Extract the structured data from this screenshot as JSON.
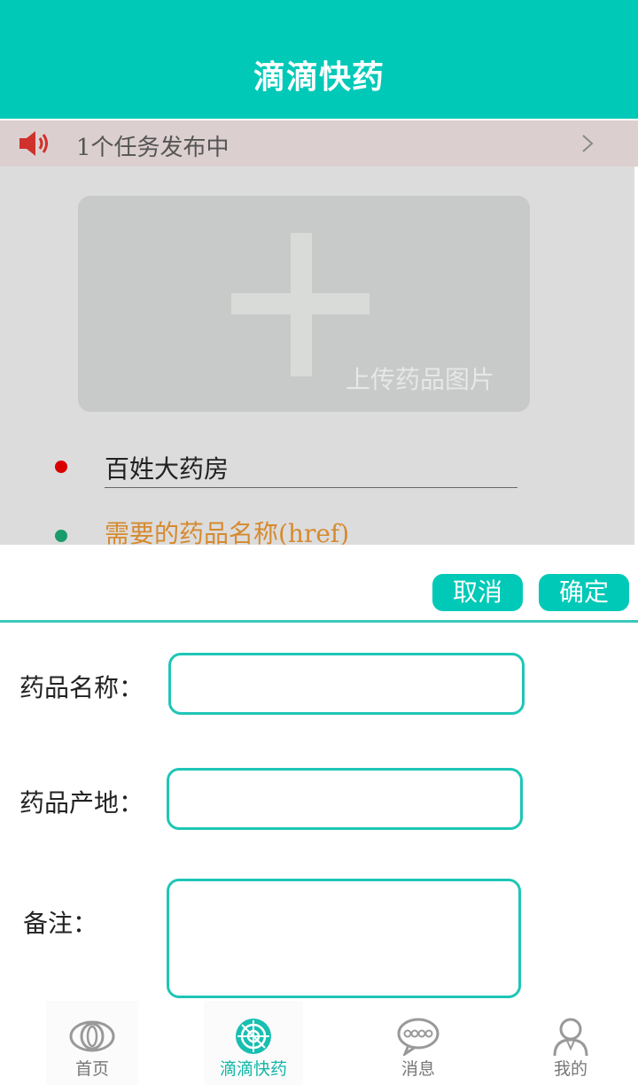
{
  "header": {
    "title": "滴滴快药"
  },
  "notice": {
    "icon": "speaker-icon",
    "text": "1个任务发布中",
    "chevron": "chevron-right-icon"
  },
  "upload": {
    "icon": "plus-icon",
    "label": "上传药品图片"
  },
  "pharmacy": {
    "name": "百姓大药房"
  },
  "need": {
    "label": "需要的药品名称(href)"
  },
  "dialog": {
    "cancel_label": "取消",
    "ok_label": "确定",
    "fields": [
      {
        "label": "药品名称：",
        "value": ""
      },
      {
        "label": "药品产地：",
        "value": ""
      },
      {
        "label": "备注：",
        "value": ""
      }
    ]
  },
  "tabbar": {
    "items": [
      {
        "label": "首页",
        "icon": "eye-icon"
      },
      {
        "label": "滴滴快药",
        "icon": "radar-icon",
        "active": true
      },
      {
        "label": "消息",
        "icon": "chat-bubble-icon"
      },
      {
        "label": "我的",
        "icon": "user-icon"
      }
    ]
  },
  "colors": {
    "accent": "#00c9b7",
    "highlight": "#d68a2e",
    "dot_red": "#d90000",
    "dot_green": "#1a9b6c"
  }
}
